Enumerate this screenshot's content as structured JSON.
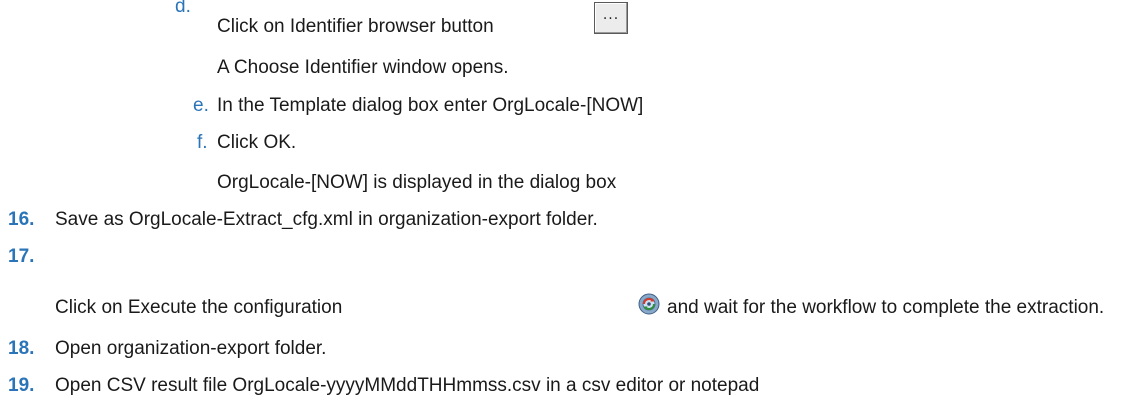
{
  "steps": {
    "d": {
      "letter": "d.",
      "text": "Click on Identifier browser button",
      "button_glyph": "...",
      "button_icon": "ellipsis-browse-icon",
      "note": "A Choose Identifier window opens."
    },
    "e": {
      "letter": "e.",
      "text": "In the Template dialog box enter OrgLocale-[NOW]"
    },
    "f": {
      "letter": "f.",
      "text": "Click OK.",
      "note": "OrgLocale-[NOW] is displayed in the dialog box"
    },
    "s16": {
      "number": "16.",
      "text": "Save as OrgLocale-Extract_cfg.xml in organization-export folder."
    },
    "s17": {
      "number": "17.",
      "text_before": "Click on Execute the configuration",
      "icon": "execute-configuration-icon",
      "text_after": "and wait for the workflow to complete the extraction."
    },
    "s18": {
      "number": "18.",
      "text": "Open organization-export folder."
    },
    "s19": {
      "number": "19.",
      "text": "Open CSV result file OrgLocale-yyyyMMddTHHmmss.csv in a csv editor or notepad"
    }
  },
  "colors": {
    "accent": "#2b74b8",
    "text": "#1a1a1a"
  }
}
